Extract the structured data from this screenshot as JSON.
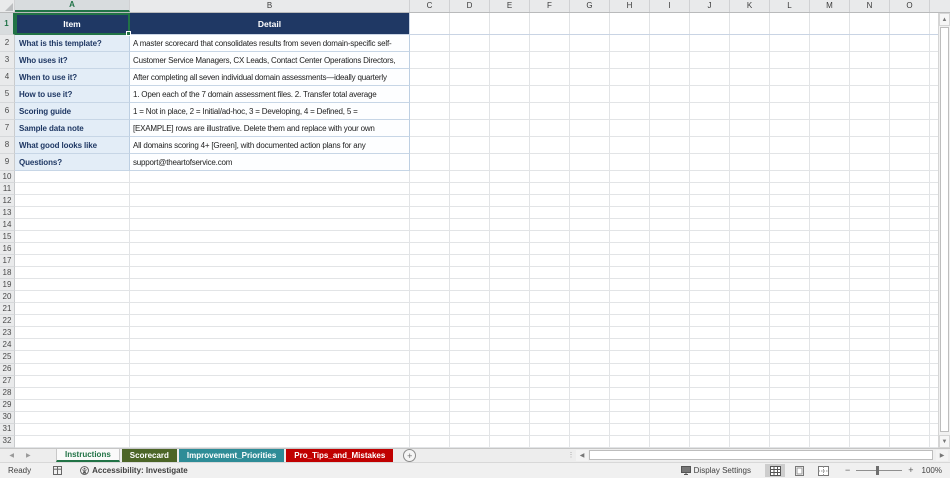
{
  "grid": {
    "columns": [
      "A",
      "B",
      "C",
      "D",
      "E",
      "F",
      "G",
      "H",
      "I",
      "J",
      "K",
      "L",
      "M",
      "N",
      "O"
    ],
    "selected_cell": "A1",
    "header_row": {
      "row": 1,
      "item": "Item",
      "detail": "Detail"
    },
    "rows": [
      {
        "row": 2,
        "item": "What is this template?",
        "detail": "A master scorecard that consolidates results from seven domain-specific self-"
      },
      {
        "row": 3,
        "item": "Who uses it?",
        "detail": "Customer Service Managers, CX Leads, Contact Center Operations Directors,"
      },
      {
        "row": 4,
        "item": "When to use it?",
        "detail": "After completing all seven individual domain assessments—ideally quarterly"
      },
      {
        "row": 5,
        "item": "How to use it?",
        "detail": "1. Open each of the 7 domain assessment files. 2. Transfer total average"
      },
      {
        "row": 6,
        "item": "Scoring guide",
        "detail": "1 = Not in place, 2 = Initial/ad-hoc, 3 = Developing, 4 = Defined, 5 ="
      },
      {
        "row": 7,
        "item": "Sample data note",
        "detail": "[EXAMPLE] rows are illustrative. Delete them and replace with your own"
      },
      {
        "row": 8,
        "item": "What good looks like",
        "detail": "All domains scoring 4+ [Green], with documented action plans for any"
      },
      {
        "row": 9,
        "item": "Questions?",
        "detail": "support@theartofservice.com"
      }
    ],
    "empty_rows": {
      "from": 10,
      "to": 32
    }
  },
  "tabs": {
    "items": [
      {
        "label": "Instructions",
        "active": true,
        "color": "#217346"
      },
      {
        "label": "Scorecard",
        "active": false,
        "color": "#4C6527"
      },
      {
        "label": "Improvement_Priorities",
        "active": false,
        "color": "#2E8C97"
      },
      {
        "label": "Pro_Tips_and_Mistakes",
        "active": false,
        "color": "#C00000"
      }
    ],
    "add_sheet_label": "+"
  },
  "status_bar": {
    "mode": "Ready",
    "accessibility": "Accessibility: Investigate",
    "display_settings": "Display Settings",
    "zoom_level": "100%",
    "zoom_minus": "−",
    "zoom_plus": "+"
  },
  "colors": {
    "table_header_bg": "#1F3864",
    "label_cell_bg": "#E3EDF7",
    "label_text": "#1F3864",
    "selection_accent": "#217346"
  }
}
